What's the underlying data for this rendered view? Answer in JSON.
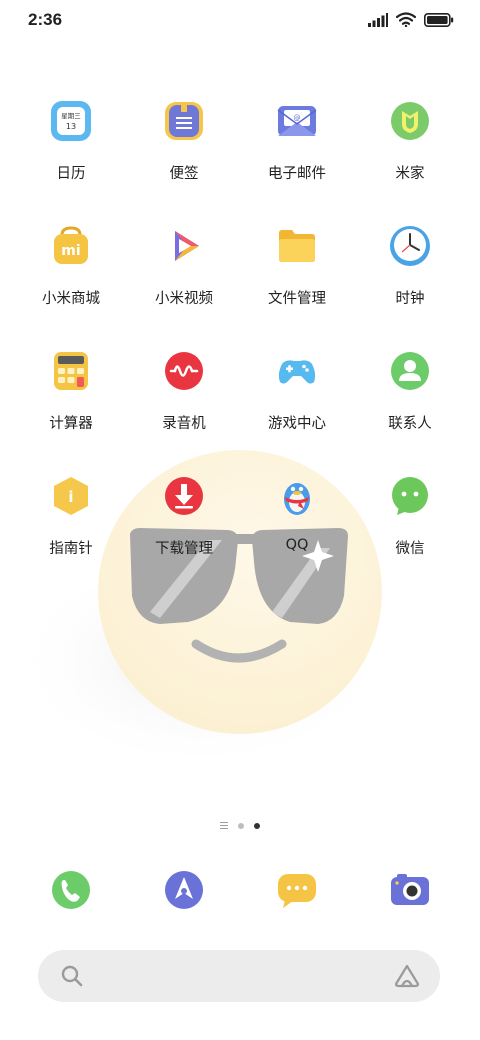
{
  "status_bar": {
    "time": "2:36"
  },
  "apps": [
    {
      "label": "日历",
      "name": "calendar",
      "icon_text_top": "星期三",
      "icon_text_bottom": "13"
    },
    {
      "label": "便签",
      "name": "notes"
    },
    {
      "label": "电子邮件",
      "name": "email",
      "icon_text": "@"
    },
    {
      "label": "米家",
      "name": "mijia"
    },
    {
      "label": "小米商城",
      "name": "mi-store",
      "icon_text": "mi"
    },
    {
      "label": "小米视频",
      "name": "mi-video"
    },
    {
      "label": "文件管理",
      "name": "file-manager"
    },
    {
      "label": "时钟",
      "name": "clock"
    },
    {
      "label": "计算器",
      "name": "calculator"
    },
    {
      "label": "录音机",
      "name": "recorder"
    },
    {
      "label": "游戏中心",
      "name": "game-center"
    },
    {
      "label": "联系人",
      "name": "contacts"
    },
    {
      "label": "指南针",
      "name": "compass",
      "icon_text": "i"
    },
    {
      "label": "下载管理",
      "name": "downloads"
    },
    {
      "label": "QQ",
      "name": "qq"
    },
    {
      "label": "微信",
      "name": "wechat"
    }
  ],
  "dock": [
    {
      "name": "phone"
    },
    {
      "name": "browser"
    },
    {
      "name": "messages"
    },
    {
      "name": "camera"
    }
  ],
  "pager": {
    "pages": 2,
    "active_index": 1
  },
  "colors": {
    "wallpaper_face": "#fdf3d8",
    "glasses": "#a9a9a9",
    "search_bg": "#ececec"
  }
}
